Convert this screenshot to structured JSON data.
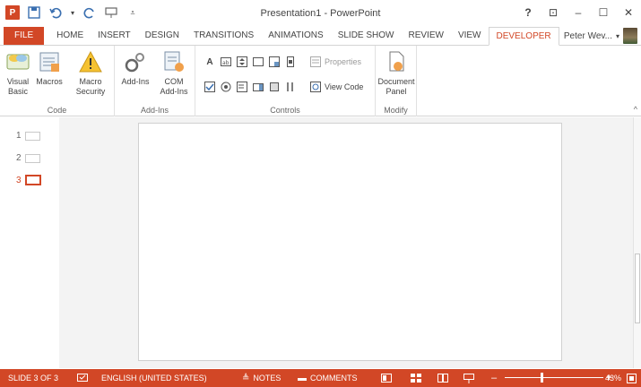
{
  "window": {
    "title": "Presentation1 - PowerPoint",
    "app_icon_text": "P"
  },
  "qat": {
    "save_icon": "save-icon",
    "undo_icon": "undo-icon",
    "redo_icon": "redo-icon",
    "start_icon": "slideshow-start-icon",
    "customize_icon": "customize-icon"
  },
  "window_controls": {
    "help": "?",
    "ribbon_display": "⊡",
    "minimize": "–",
    "maximize": "☐",
    "close": "✕"
  },
  "tabs": [
    "FILE",
    "HOME",
    "INSERT",
    "DESIGN",
    "TRANSITIONS",
    "ANIMATIONS",
    "SLIDE SHOW",
    "REVIEW",
    "VIEW",
    "DEVELOPER"
  ],
  "active_tab": "DEVELOPER",
  "user": {
    "name": "Peter Wev...",
    "dropdown": "▾"
  },
  "ribbon": {
    "groups": {
      "code": {
        "label": "Code",
        "visual_basic": [
          "Visual",
          "Basic"
        ],
        "macros": [
          "Macros",
          ""
        ],
        "macro_security": [
          "Macro",
          "Security"
        ]
      },
      "addins": {
        "label": "Add-Ins",
        "addins": [
          "Add-Ins",
          ""
        ],
        "com_addins": [
          "COM",
          "Add-Ins"
        ]
      },
      "controls": {
        "label": "Controls",
        "properties": "Properties",
        "view_code": "View Code"
      },
      "modify": {
        "label": "Modify",
        "document_panel": [
          "Document",
          "Panel"
        ]
      }
    },
    "collapse": "^"
  },
  "slides": [
    {
      "number": "1"
    },
    {
      "number": "2"
    },
    {
      "number": "3"
    }
  ],
  "active_slide": "3",
  "statusbar": {
    "slide_indicator": "SLIDE 3 OF 3",
    "language": "ENGLISH (UNITED STATES)",
    "notes": "NOTES",
    "comments": "COMMENTS",
    "zoom_minus": "–",
    "zoom_plus": "+",
    "zoom_level": "43%"
  },
  "colors": {
    "accent": "#d24726",
    "canvas": "#f3f3f3"
  }
}
